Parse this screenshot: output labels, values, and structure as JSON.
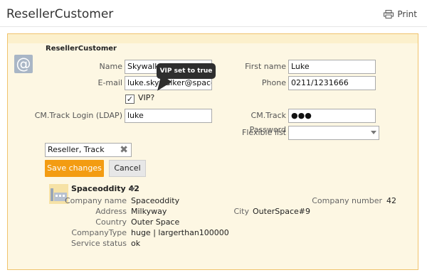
{
  "header": {
    "title": "ResellerCustomer",
    "print_label": "Print"
  },
  "form": {
    "section_title": "ResellerCustomer",
    "name_label": "Name",
    "name_value": "Skywalker",
    "first_name_label": "First name",
    "first_name_value": "Luke",
    "email_label": "E-mail",
    "email_value": "luke.skywalker@spaceoddity",
    "phone_label": "Phone",
    "phone_value": "0211/1231666",
    "vip_label": "VIP?",
    "vip_checked": true,
    "login_label": "CM.Track Login (LDAP)",
    "login_value": "luke",
    "password_label": "CM.Track Password",
    "password_value": "●●●",
    "flexible_label": "Flexible list",
    "flexible_value": "",
    "tag_value": "Reseller, Track",
    "tooltip": "VIP set to true",
    "save_label": "Save changes",
    "cancel_label": "Cancel"
  },
  "company": {
    "title": "Spaceoddity 42",
    "company_name_label": "Company name",
    "company_name_value": "Spaceoddity",
    "address_label": "Address",
    "address_value": "Milkyway",
    "country_label": "Country",
    "country_value": "Outer Space",
    "type_label": "CompanyType",
    "type_value": "huge | largerthan100000",
    "status_label": "Service status",
    "status_value": "ok",
    "city_label": "City",
    "city_value": "OuterSpace#9",
    "number_label": "Company number",
    "number_value": "42"
  },
  "icons": {
    "at": "at-icon",
    "print": "print-icon",
    "building": "building-icon",
    "check": "check-icon",
    "clear": "clear-icon"
  },
  "colors": {
    "accent": "#f39c12",
    "panel_bg": "#fdf7e3",
    "panel_border": "#f0c36d",
    "tooltip_bg": "#2e2e2e"
  }
}
